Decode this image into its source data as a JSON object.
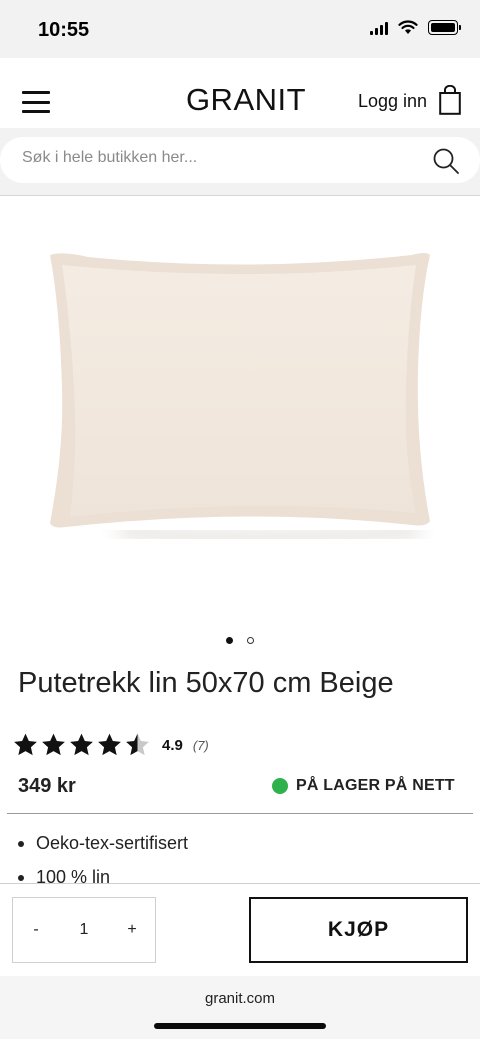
{
  "status_bar": {
    "time": "10:55"
  },
  "header": {
    "brand": "GRANIT",
    "login_label": "Logg inn"
  },
  "search": {
    "placeholder": "Søk i hele butikken her..."
  },
  "product": {
    "title": "Putetrekk lin 50x70 cm Beige",
    "rating_value": "4.9",
    "rating_count": "(7)",
    "rating_stars": 4.5,
    "price": "349 kr",
    "stock_label": "PÅ LAGER PÅ NETT",
    "stock_color": "#2fb24c",
    "features": [
      "Oeko-tex-sertifisert",
      "100 % lin"
    ],
    "image_icon": "pillow-image",
    "gallery": {
      "total": 2,
      "active": 1
    }
  },
  "buy": {
    "minus_label": "-",
    "quantity": "1",
    "plus_label": "+",
    "buy_label": "KJØP"
  },
  "browser": {
    "url": "granit.com"
  }
}
